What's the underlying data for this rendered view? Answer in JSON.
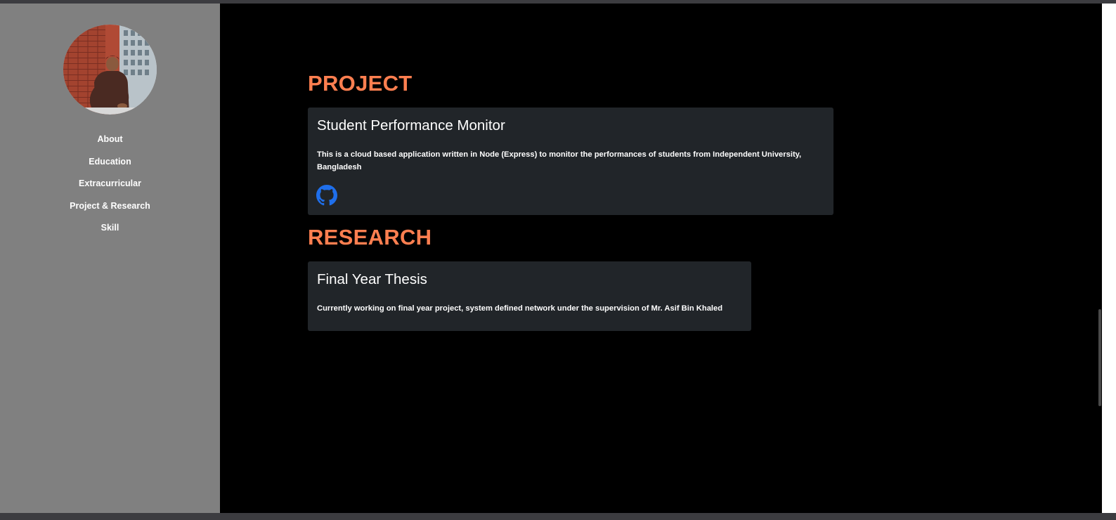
{
  "sidebar": {
    "avatar_alt": "Profile photo",
    "nav": [
      {
        "label": "About"
      },
      {
        "label": "Education"
      },
      {
        "label": "Extracurricular"
      },
      {
        "label": "Project & Research"
      },
      {
        "label": "Skill"
      }
    ]
  },
  "project": {
    "heading": "PROJECT",
    "card": {
      "title": "Student Performance Monitor",
      "description": "This is a cloud based application written in Node (Express) to monitor the performances of students from Independent University, Bangladesh",
      "link_icon": "github-icon"
    }
  },
  "research": {
    "heading": "RESEARCH",
    "card": {
      "title": "Final Year Thesis",
      "description": "Currently working on final year project, system defined network under the supervision of Mr. Asif Bin Khaled"
    }
  },
  "colors": {
    "accent": "#ff7f50",
    "sidebar_bg": "#808080",
    "main_bg": "#000000",
    "card_bg": "#212529",
    "github_blue": "#1f6feb"
  }
}
